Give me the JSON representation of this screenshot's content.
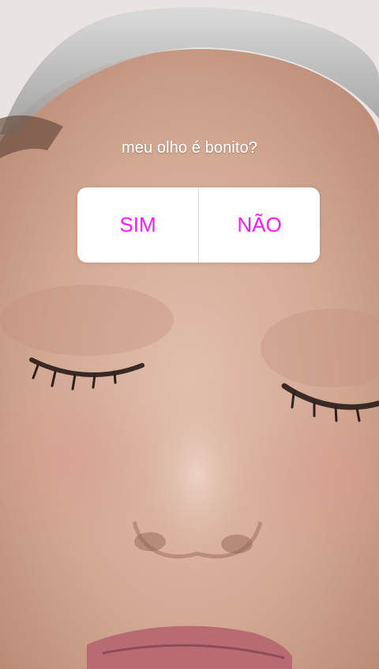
{
  "story": {
    "photo_description_icon": "face-photo",
    "question_sticker": {
      "question": "meu olho é bonito?",
      "option_yes": "SIM",
      "option_no": "NÃO",
      "option_color": "#ff1aff"
    }
  }
}
